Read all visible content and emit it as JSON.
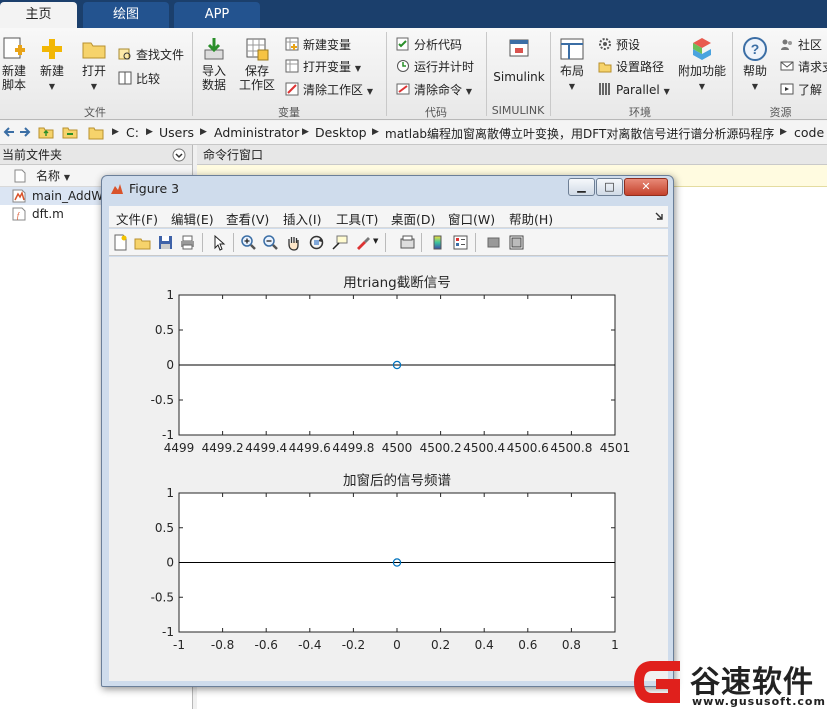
{
  "ribbon_tabs": [
    {
      "label": "主页",
      "active": true
    },
    {
      "label": "绘图",
      "active": false
    },
    {
      "label": "APP",
      "active": false
    }
  ],
  "ribbon": {
    "file": {
      "new_script": "新建\n脚本",
      "new": "新建",
      "open": "打开",
      "find_files": "查找文件",
      "compare": "比较",
      "group_label": "文件"
    },
    "variable": {
      "import_data": "导入\n数据",
      "save_workspace": "保存\n工作区",
      "new_variable": "新建变量",
      "open_variable": "打开变量",
      "clear_workspace": "清除工作区",
      "group_label": "变量"
    },
    "code": {
      "analyze_code": "分析代码",
      "run_and_time": "运行并计时",
      "clear_commands": "清除命令",
      "group_label": "代码"
    },
    "simulink": {
      "label": "Simulink",
      "group_label": "SIMULINK"
    },
    "environment": {
      "layout": "布局",
      "preferences": "预设",
      "set_path": "设置路径",
      "parallel": "Parallel",
      "addons": "附加功能",
      "group_label": "环境"
    },
    "resources": {
      "help": "帮助",
      "community": "社区",
      "request_support": "请求支",
      "learn": "了解",
      "group_label": "资源"
    }
  },
  "address": {
    "crumbs": [
      "C:",
      "Users",
      "Administrator",
      "Desktop",
      "matlab编程加窗离散傅立叶变换，用DFT对离散信号进行谱分析源码程序",
      "code"
    ]
  },
  "left_panel": {
    "title": "当前文件夹",
    "column_name": "名称",
    "files": [
      {
        "name": "main_AddW",
        "selected": true
      },
      {
        "name": "dft.m",
        "selected": false
      }
    ]
  },
  "command_window": {
    "title": "命令行窗口"
  },
  "figure": {
    "title": "Figure 3",
    "menu": [
      "文件(F)",
      "编辑(E)",
      "查看(V)",
      "插入(I)",
      "工具(T)",
      "桌面(D)",
      "窗口(W)",
      "帮助(H)"
    ],
    "toolbar_icons": [
      "new-figure-icon",
      "open-file-icon",
      "save-icon",
      "print-icon",
      "pointer-icon",
      "zoom-in-icon",
      "zoom-out-icon",
      "pan-icon",
      "rotate-3d-icon",
      "data-cursor-icon",
      "brush-icon",
      "link-plot-icon",
      "colorbar-icon",
      "legend-icon",
      "hide-plot-tools-icon",
      "show-plot-tools-icon"
    ]
  },
  "chart_data": [
    {
      "type": "scatter",
      "title": "用triang截断信号",
      "xlabel": "",
      "ylabel": "",
      "xlim": [
        4499,
        4501
      ],
      "ylim": [
        -1,
        1
      ],
      "xticks": [
        "4499",
        "4499.2",
        "4499.4",
        "4499.6",
        "4499.8",
        "4500",
        "4500.2",
        "4500.4",
        "4500.6",
        "4500.8",
        "4501"
      ],
      "yticks": [
        "1",
        "0.5",
        "0",
        "-0.5",
        "-1"
      ],
      "baseline_y": 0,
      "points": [
        {
          "x": 4500,
          "y": 0
        }
      ],
      "grid": false,
      "marker_color": "#0072bd"
    },
    {
      "type": "scatter",
      "title": "加窗后的信号频谱",
      "xlabel": "",
      "ylabel": "",
      "xlim": [
        -1,
        1
      ],
      "ylim": [
        -1,
        1
      ],
      "xticks": [
        "-1",
        "-0.8",
        "-0.6",
        "-0.4",
        "-0.2",
        "0",
        "0.2",
        "0.4",
        "0.6",
        "0.8",
        "1"
      ],
      "yticks": [
        "1",
        "0.5",
        "0",
        "-0.5",
        "-1"
      ],
      "baseline_y": 0,
      "points": [
        {
          "x": 0,
          "y": 0
        }
      ],
      "grid": false,
      "marker_color": "#0072bd"
    }
  ],
  "watermark": {
    "brand": "谷速软件",
    "url": "www.gususoft.com",
    "brand_color": "#e0201c"
  }
}
